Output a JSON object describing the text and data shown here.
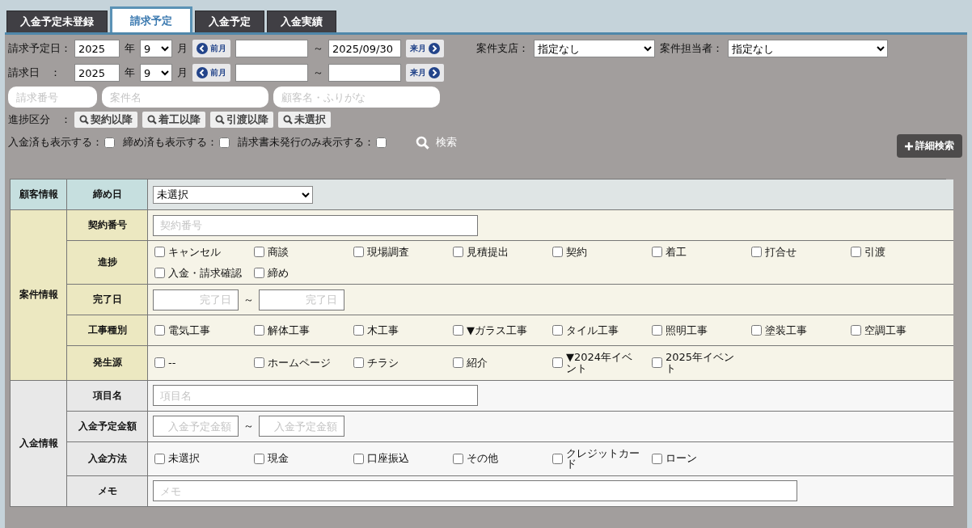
{
  "tabs": [
    {
      "label": "入金予定未登録",
      "selected": false
    },
    {
      "label": "請求予定",
      "selected": true
    },
    {
      "label": "入金予定",
      "selected": false
    },
    {
      "label": "入金実績",
      "selected": false
    }
  ],
  "date_rows": [
    {
      "label": "請求予定日：",
      "year": "2025",
      "year_unit": "年",
      "month": "9",
      "month_unit": "月",
      "prev": "前月",
      "tilde": "～",
      "to": "2025/09/30",
      "next": "来月"
    },
    {
      "label": "請求日　：",
      "year": "2025",
      "year_unit": "年",
      "month": "9",
      "month_unit": "月",
      "prev": "前月",
      "tilde": "～",
      "next": "来月"
    }
  ],
  "extra_selects": [
    {
      "label": "案件支店：",
      "value": "指定なし"
    },
    {
      "label": "案件担当者：",
      "value": "指定なし"
    }
  ],
  "text_fields": [
    {
      "placeholder": "請求番号"
    },
    {
      "placeholder": "案件名"
    },
    {
      "placeholder": "顧客名・ふりがな"
    }
  ],
  "progress_filter": {
    "label": "進捗区分　：",
    "buttons": [
      "契約以降",
      "着工以降",
      "引渡以降",
      "未選択"
    ]
  },
  "toggles": [
    {
      "label": "入金済も表示する：",
      "checked": false
    },
    {
      "label": "締め済も表示する：",
      "checked": false
    },
    {
      "label": "請求書未発行のみ表示する：",
      "checked": false
    }
  ],
  "search_button": "検索",
  "detail_button": "詳細検索",
  "sections": [
    {
      "heading": "顧客情報",
      "kind": "customer",
      "rows": [
        {
          "label": "締め日",
          "kind": "select",
          "value": "未選択"
        }
      ]
    },
    {
      "heading": "案件情報",
      "kind": "case",
      "rows": [
        {
          "label": "契約番号",
          "kind": "text",
          "placeholder": "契約番号"
        },
        {
          "label": "進捗",
          "kind": "checks",
          "options": [
            {
              "label": "キャンセル",
              "checked": false
            },
            {
              "label": "商談",
              "checked": false
            },
            {
              "label": "現場調査",
              "checked": false
            },
            {
              "label": "見積提出",
              "checked": false
            },
            {
              "label": "契約",
              "checked": false
            },
            {
              "label": "着工",
              "checked": false
            },
            {
              "label": "打合せ",
              "checked": false
            },
            {
              "label": "引渡",
              "checked": false
            },
            {
              "label": "入金・請求確認",
              "checked": false
            },
            {
              "label": "締め",
              "checked": false
            }
          ]
        },
        {
          "label": "完了日",
          "kind": "range",
          "from_placeholder": "完了日",
          "tilde": "～",
          "to_placeholder": "完了日"
        },
        {
          "label": "工事種別",
          "kind": "checks",
          "options": [
            {
              "label": "電気工事",
              "checked": false
            },
            {
              "label": "解体工事",
              "checked": false
            },
            {
              "label": "木工事",
              "checked": false
            },
            {
              "label": "▼ガラス工事",
              "checked": false
            },
            {
              "label": "タイル工事",
              "checked": false
            },
            {
              "label": "照明工事",
              "checked": false
            },
            {
              "label": "塗装工事",
              "checked": false
            },
            {
              "label": "空調工事",
              "checked": false
            }
          ]
        },
        {
          "label": "発生源",
          "kind": "checks",
          "options": [
            {
              "label": "--",
              "checked": false
            },
            {
              "label": "ホームページ",
              "checked": false
            },
            {
              "label": "チラシ",
              "checked": false
            },
            {
              "label": "紹介",
              "checked": false
            },
            {
              "label": "▼2024年イベント",
              "checked": false
            },
            {
              "label": "2025年イベント",
              "checked": false
            }
          ]
        }
      ]
    },
    {
      "heading": "入金情報",
      "kind": "payment",
      "rows": [
        {
          "label": "項目名",
          "kind": "text",
          "placeholder": "項目名"
        },
        {
          "label": "入金予定金額",
          "kind": "range",
          "from_placeholder": "入金予定金額",
          "tilde": "～",
          "to_placeholder": "入金予定金額"
        },
        {
          "label": "入金方法",
          "kind": "checks",
          "options": [
            {
              "label": "未選択",
              "checked": false
            },
            {
              "label": "現金",
              "checked": false
            },
            {
              "label": "口座振込",
              "checked": false
            },
            {
              "label": "その他",
              "checked": false
            },
            {
              "label": "クレジットカード",
              "checked": false
            },
            {
              "label": "ローン",
              "checked": false
            }
          ]
        },
        {
          "label": "メモ",
          "kind": "wide_text",
          "placeholder": "メモ"
        }
      ]
    }
  ]
}
